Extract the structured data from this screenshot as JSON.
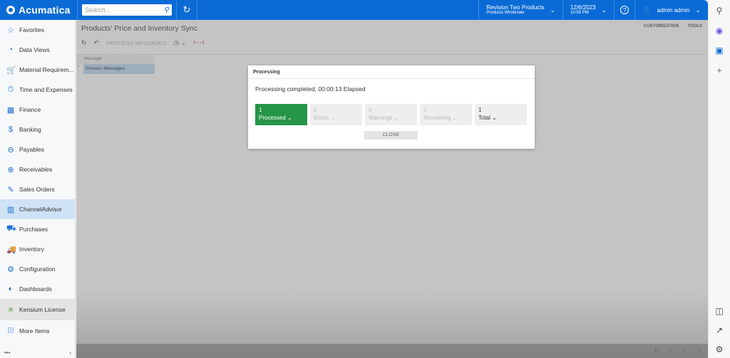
{
  "topbar": {
    "brand": "Acumatica",
    "search_placeholder": "Search...",
    "company_line1": "Revision Two Products",
    "company_line2": "Products Wholesale",
    "date": "12/6/2023",
    "time": "10:59 PM",
    "user": "admin admin"
  },
  "sidebar": {
    "items": [
      {
        "label": "Favorites",
        "icon": "☆"
      },
      {
        "label": "Data Views",
        "icon": "◔"
      },
      {
        "label": "Material Requirem...",
        "icon": "🛒"
      },
      {
        "label": "Time and Expenses",
        "icon": "⏱"
      },
      {
        "label": "Finance",
        "icon": "▦"
      },
      {
        "label": "Banking",
        "icon": "$"
      },
      {
        "label": "Payables",
        "icon": "⊖"
      },
      {
        "label": "Receivables",
        "icon": "⊕"
      },
      {
        "label": "Sales Orders",
        "icon": "✎"
      },
      {
        "label": "ChannelAdvisor",
        "icon": "▥"
      },
      {
        "label": "Purchases",
        "icon": "⛟"
      },
      {
        "label": "Inventory",
        "icon": "🚚"
      },
      {
        "label": "Configuration",
        "icon": "⚙"
      },
      {
        "label": "Dashboards",
        "icon": "◐"
      }
    ],
    "kensium": "Kensium License",
    "more": "More Items",
    "footer_dots": "•••",
    "collapse": "‹"
  },
  "page": {
    "title": "Products' Price and Inventory Sync",
    "customization": "CUSTOMIZATION",
    "tools": "TOOLS",
    "process_messages": "PROCESS MESSAGES",
    "grid_header": "Message",
    "grid_row": "Process Messages"
  },
  "dialog": {
    "title": "Processing",
    "message": "Processing completed, 00:00:13 Elapsed",
    "stats": [
      {
        "value": "1",
        "label": "Processed"
      },
      {
        "value": "0",
        "label": "Errors"
      },
      {
        "value": "0",
        "label": "Warnings"
      },
      {
        "value": "0",
        "label": "Remaining"
      },
      {
        "value": "1",
        "label": "Total"
      }
    ],
    "close": "CLOSE"
  }
}
